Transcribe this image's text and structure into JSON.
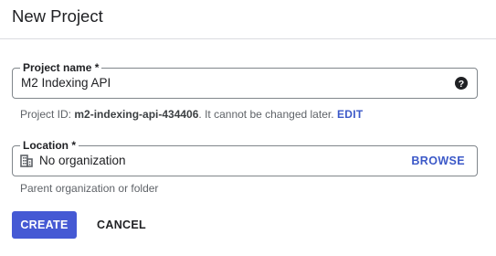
{
  "dialog": {
    "title": "New Project"
  },
  "project_name": {
    "label": "Project name *",
    "value": "M2 Indexing API",
    "help_icon": "help-circle-icon"
  },
  "project_id": {
    "prefix": "Project ID: ",
    "id": "m2-indexing-api-434406",
    "suffix": ". It cannot be changed later.",
    "edit_label": "EDIT"
  },
  "location": {
    "label": "Location *",
    "value": "No organization",
    "icon": "building-icon",
    "browse_label": "BROWSE",
    "hint": "Parent organization or folder"
  },
  "actions": {
    "create_label": "CREATE",
    "cancel_label": "CANCEL"
  },
  "colors": {
    "accent": "#4559d4",
    "link": "#3c59c8",
    "border": "#80868b"
  }
}
